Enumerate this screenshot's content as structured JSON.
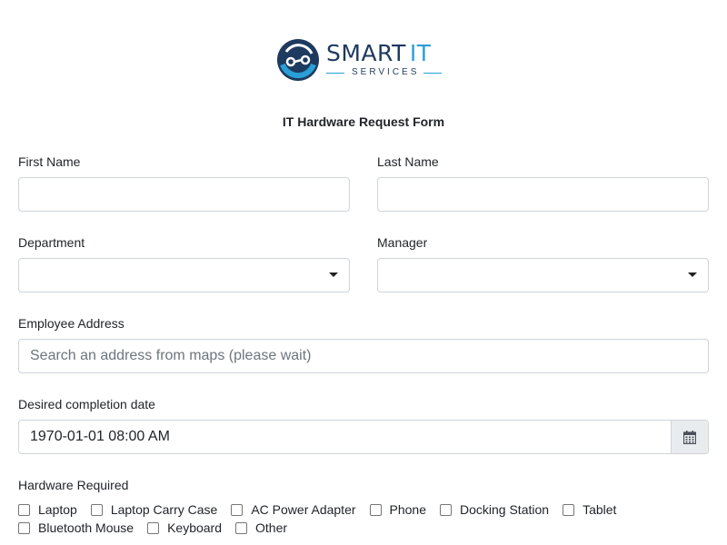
{
  "brand": {
    "name_part1": "SMART",
    "name_part2": "IT",
    "subtitle": "SERVICES",
    "colors": {
      "dark": "#1e3a5f",
      "accent": "#2a9fd6"
    }
  },
  "form": {
    "title": "IT Hardware Request Form",
    "first_name": {
      "label": "First Name",
      "value": ""
    },
    "last_name": {
      "label": "Last Name",
      "value": ""
    },
    "department": {
      "label": "Department",
      "value": ""
    },
    "manager": {
      "label": "Manager",
      "value": ""
    },
    "address": {
      "label": "Employee Address",
      "placeholder": "Search an address from maps (please wait)",
      "value": ""
    },
    "completion_date": {
      "label": "Desired completion date",
      "value": "1970-01-01 08:00 AM",
      "icon": "calendar-icon"
    },
    "hardware": {
      "label": "Hardware Required",
      "options": [
        "Laptop",
        "Laptop Carry Case",
        "AC Power Adapter",
        "Phone",
        "Docking Station",
        "Tablet",
        "Bluetooth Mouse",
        "Keyboard",
        "Other"
      ]
    }
  }
}
